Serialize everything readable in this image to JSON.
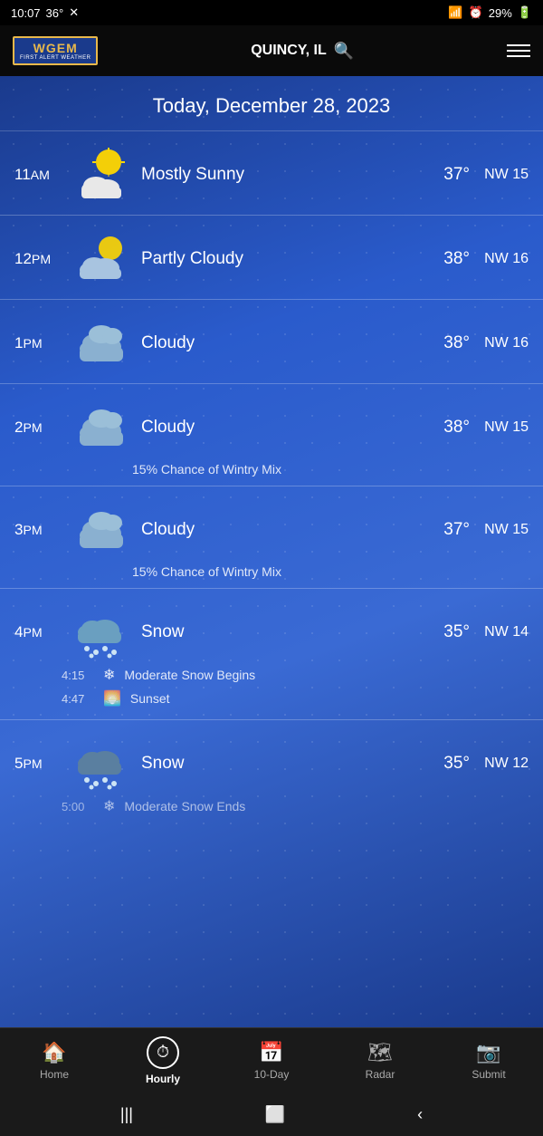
{
  "statusBar": {
    "time": "10:07",
    "temp": "36°",
    "battery": "29%"
  },
  "topNav": {
    "logo": "WGEM",
    "logoSub": "FIRST ALERT WEATHER",
    "location": "QUINCY, IL"
  },
  "dateHeader": "Today, December 28, 2023",
  "rows": [
    {
      "time": "11AM",
      "condition": "Mostly Sunny",
      "temp": "37°",
      "wind": "NW 15",
      "icon": "mostly-sunny",
      "subInfo": null,
      "events": []
    },
    {
      "time": "12PM",
      "condition": "Partly Cloudy",
      "temp": "38°",
      "wind": "NW 16",
      "icon": "partly-cloudy",
      "subInfo": null,
      "events": []
    },
    {
      "time": "1PM",
      "condition": "Cloudy",
      "temp": "38°",
      "wind": "NW 16",
      "icon": "cloudy",
      "subInfo": null,
      "events": []
    },
    {
      "time": "2PM",
      "condition": "Cloudy",
      "temp": "38°",
      "wind": "NW 15",
      "icon": "cloudy",
      "subInfo": "15% Chance of Wintry Mix",
      "events": []
    },
    {
      "time": "3PM",
      "condition": "Cloudy",
      "temp": "37°",
      "wind": "NW 15",
      "icon": "cloudy",
      "subInfo": "15% Chance of Wintry Mix",
      "events": []
    },
    {
      "time": "4PM",
      "condition": "Snow",
      "temp": "35°",
      "wind": "NW 14",
      "icon": "snow",
      "subInfo": null,
      "events": [
        {
          "time": "4:15",
          "icon": "❄",
          "text": "Moderate Snow Begins"
        },
        {
          "time": "4:47",
          "icon": "🌅",
          "text": "Sunset"
        }
      ]
    },
    {
      "time": "5PM",
      "condition": "Snow",
      "temp": "35°",
      "wind": "NW 12",
      "icon": "snow-dark",
      "subInfo": null,
      "events": [
        {
          "time": "5:00",
          "icon": "",
          "text": "Moderate Snow Ends"
        }
      ]
    }
  ],
  "tabs": [
    {
      "label": "Home",
      "icon": "🏠",
      "active": false
    },
    {
      "label": "Hourly",
      "icon": "⏱",
      "active": true
    },
    {
      "label": "10-Day",
      "icon": "📅",
      "active": false
    },
    {
      "label": "Radar",
      "icon": "🗺",
      "active": false
    },
    {
      "label": "Submit",
      "icon": "📷",
      "active": false
    }
  ]
}
